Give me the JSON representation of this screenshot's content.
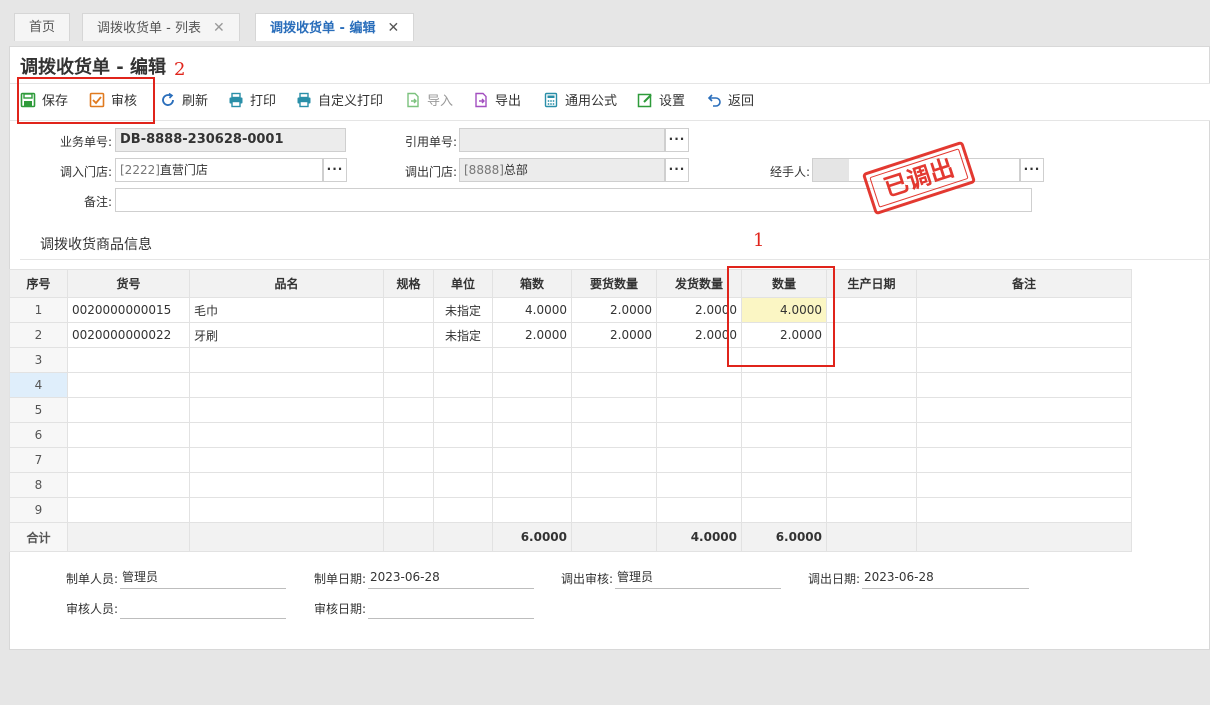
{
  "tabs": [
    {
      "label": "首页",
      "closable": false
    },
    {
      "label": "调拨收货单 - 列表",
      "closable": true
    },
    {
      "label": "调拨收货单 - 编辑",
      "closable": true,
      "active": true
    }
  ],
  "tab_close_glyph": "✕",
  "page_title": "调拨收货单 - 编辑",
  "toolbar": {
    "save": "保存",
    "audit": "审核",
    "refresh": "刷新",
    "print": "打印",
    "custom_print": "自定义打印",
    "import": "导入",
    "export": "导出",
    "formula": "通用公式",
    "settings": "设置",
    "back": "返回"
  },
  "annotations": {
    "one": "1",
    "two": "2"
  },
  "colors": {
    "accent": "#2a6ebb",
    "annotation": "#e0241b",
    "highlight": "#fbf6c4"
  },
  "form": {
    "doc_no_label": "业务单号:",
    "doc_no": "DB-8888-230628-0001",
    "ref_no_label": "引用单号:",
    "ref_no": "",
    "in_store_label": "调入门店:",
    "in_store_code": "[2222]",
    "in_store_name": "直营门店",
    "out_store_label": "调出门店:",
    "out_store_code": "[8888]",
    "out_store_name": "总部",
    "handler_label": "经手人:",
    "handler": "",
    "remark_label": "备注:",
    "remark": "",
    "dots": "···"
  },
  "stamp": "已调出",
  "section_title": "调拨收货商品信息",
  "grid": {
    "headers": [
      "序号",
      "货号",
      "品名",
      "规格",
      "单位",
      "箱数",
      "要货数量",
      "发货数量",
      "数量",
      "生产日期",
      "备注"
    ],
    "rows": [
      {
        "seq": "1",
        "code": "0020000000015",
        "name": "毛巾",
        "spec": "",
        "unit": "未指定",
        "boxes": "4.0000",
        "req_qty": "2.0000",
        "ship_qty": "2.0000",
        "qty": "4.0000",
        "prod_date": "",
        "remark": ""
      },
      {
        "seq": "2",
        "code": "0020000000022",
        "name": "牙刷",
        "spec": "",
        "unit": "未指定",
        "boxes": "2.0000",
        "req_qty": "2.0000",
        "ship_qty": "2.0000",
        "qty": "2.0000",
        "prod_date": "",
        "remark": ""
      },
      {
        "seq": "3",
        "code": "",
        "name": "",
        "spec": "",
        "unit": "",
        "boxes": "",
        "req_qty": "",
        "ship_qty": "",
        "qty": "",
        "prod_date": "",
        "remark": ""
      },
      {
        "seq": "4",
        "code": "",
        "name": "",
        "spec": "",
        "unit": "",
        "boxes": "",
        "req_qty": "",
        "ship_qty": "",
        "qty": "",
        "prod_date": "",
        "remark": ""
      },
      {
        "seq": "5",
        "code": "",
        "name": "",
        "spec": "",
        "unit": "",
        "boxes": "",
        "req_qty": "",
        "ship_qty": "",
        "qty": "",
        "prod_date": "",
        "remark": ""
      },
      {
        "seq": "6",
        "code": "",
        "name": "",
        "spec": "",
        "unit": "",
        "boxes": "",
        "req_qty": "",
        "ship_qty": "",
        "qty": "",
        "prod_date": "",
        "remark": ""
      },
      {
        "seq": "7",
        "code": "",
        "name": "",
        "spec": "",
        "unit": "",
        "boxes": "",
        "req_qty": "",
        "ship_qty": "",
        "qty": "",
        "prod_date": "",
        "remark": ""
      },
      {
        "seq": "8",
        "code": "",
        "name": "",
        "spec": "",
        "unit": "",
        "boxes": "",
        "req_qty": "",
        "ship_qty": "",
        "qty": "",
        "prod_date": "",
        "remark": ""
      },
      {
        "seq": "9",
        "code": "",
        "name": "",
        "spec": "",
        "unit": "",
        "boxes": "",
        "req_qty": "",
        "ship_qty": "",
        "qty": "",
        "prod_date": "",
        "remark": ""
      }
    ],
    "totals": {
      "label": "合计",
      "boxes": "6.0000",
      "ship_qty": "4.0000",
      "qty": "6.0000"
    }
  },
  "footer": {
    "maker_label": "制单人员:",
    "maker": "管理员",
    "make_date_label": "制单日期:",
    "make_date": "2023-06-28",
    "out_audit_label": "调出审核:",
    "out_audit": "管理员",
    "out_date_label": "调出日期:",
    "out_date": "2023-06-28",
    "auditor_label": "审核人员:",
    "auditor": "",
    "audit_date_label": "审核日期:",
    "audit_date": ""
  }
}
